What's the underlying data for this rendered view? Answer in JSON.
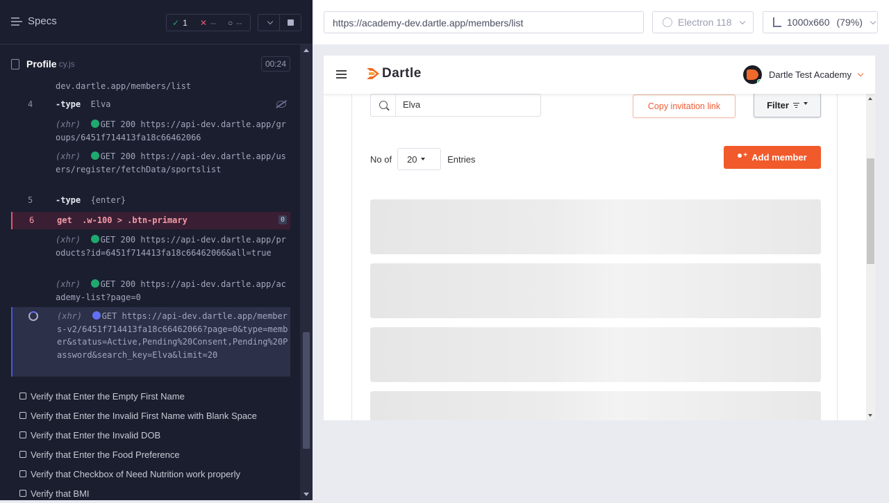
{
  "reporter": {
    "specs_label": "Specs",
    "stats": {
      "passed": "1",
      "failed": "--",
      "pending": "--"
    },
    "spec_name": "Profile",
    "spec_ext": "cy.js",
    "duration": "00:24",
    "log": {
      "r0_url": "dev.dartle.app/members/list",
      "r1_num": "4",
      "r1_name": "-type",
      "r1_arg": "Elva",
      "r2_label": "(xhr)",
      "r2_url": "GET 200 https://api-dev.dartle.app/groups/6451f714413fa18c66462066",
      "r3_label": "(xhr)",
      "r3_url": "GET 200 https://api-dev.dartle.app/users/register/fetchData/sportslist",
      "r4_num": "5",
      "r4_name": "-type",
      "r4_arg": "{enter}",
      "r5_num": "6",
      "r5_name": "get",
      "r5_arg": ".w-100 > .btn-primary",
      "r5_count": "0",
      "r6_label": "(xhr)",
      "r6_url": "GET 200 https://api-dev.dartle.app/products?id=6451f714413fa18c66462066&all=true",
      "r7_label": "(xhr)",
      "r7_url": "GET 200 https://api-dev.dartle.app/academy-list?page=0",
      "r8_label": "(xhr)",
      "r8_url": "GET https://api-dev.dartle.app/members-v2/6451f714413fa18c66462066?page=0&type=member&status=Active,Pending%20Consent,Pending%20Password&search_key=Elva&limit=20"
    },
    "tests": [
      "Verify that Enter the Empty First Name",
      "Verify that Enter the Invalid First Name with Blank Space",
      "Verify that Enter the Invalid DOB",
      "Verify that Enter the Food Preference",
      "Verify that Checkbox of Need Nutrition work properly",
      "Verify that BMI"
    ]
  },
  "aut_bar": {
    "url": "https://academy-dev.dartle.app/members/list",
    "browser": "Electron 118",
    "viewport": "1000x660",
    "scale": "(79%)"
  },
  "app": {
    "brand": "Dartle",
    "account_name": "Dartle Test Academy",
    "search_value": "Elva",
    "copy_link_label": "Copy invitation link",
    "filter_label": "Filter",
    "entries_prefix": "No of",
    "entries_value": "20",
    "entries_suffix": "Entries",
    "add_member_label": "Add member"
  },
  "colors": {
    "accent": "#f15a2b",
    "reporter_bg": "#1b1e2e",
    "pass_green": "#1fa971",
    "fail_red": "#e45770",
    "active_blue": "#6470f3"
  }
}
